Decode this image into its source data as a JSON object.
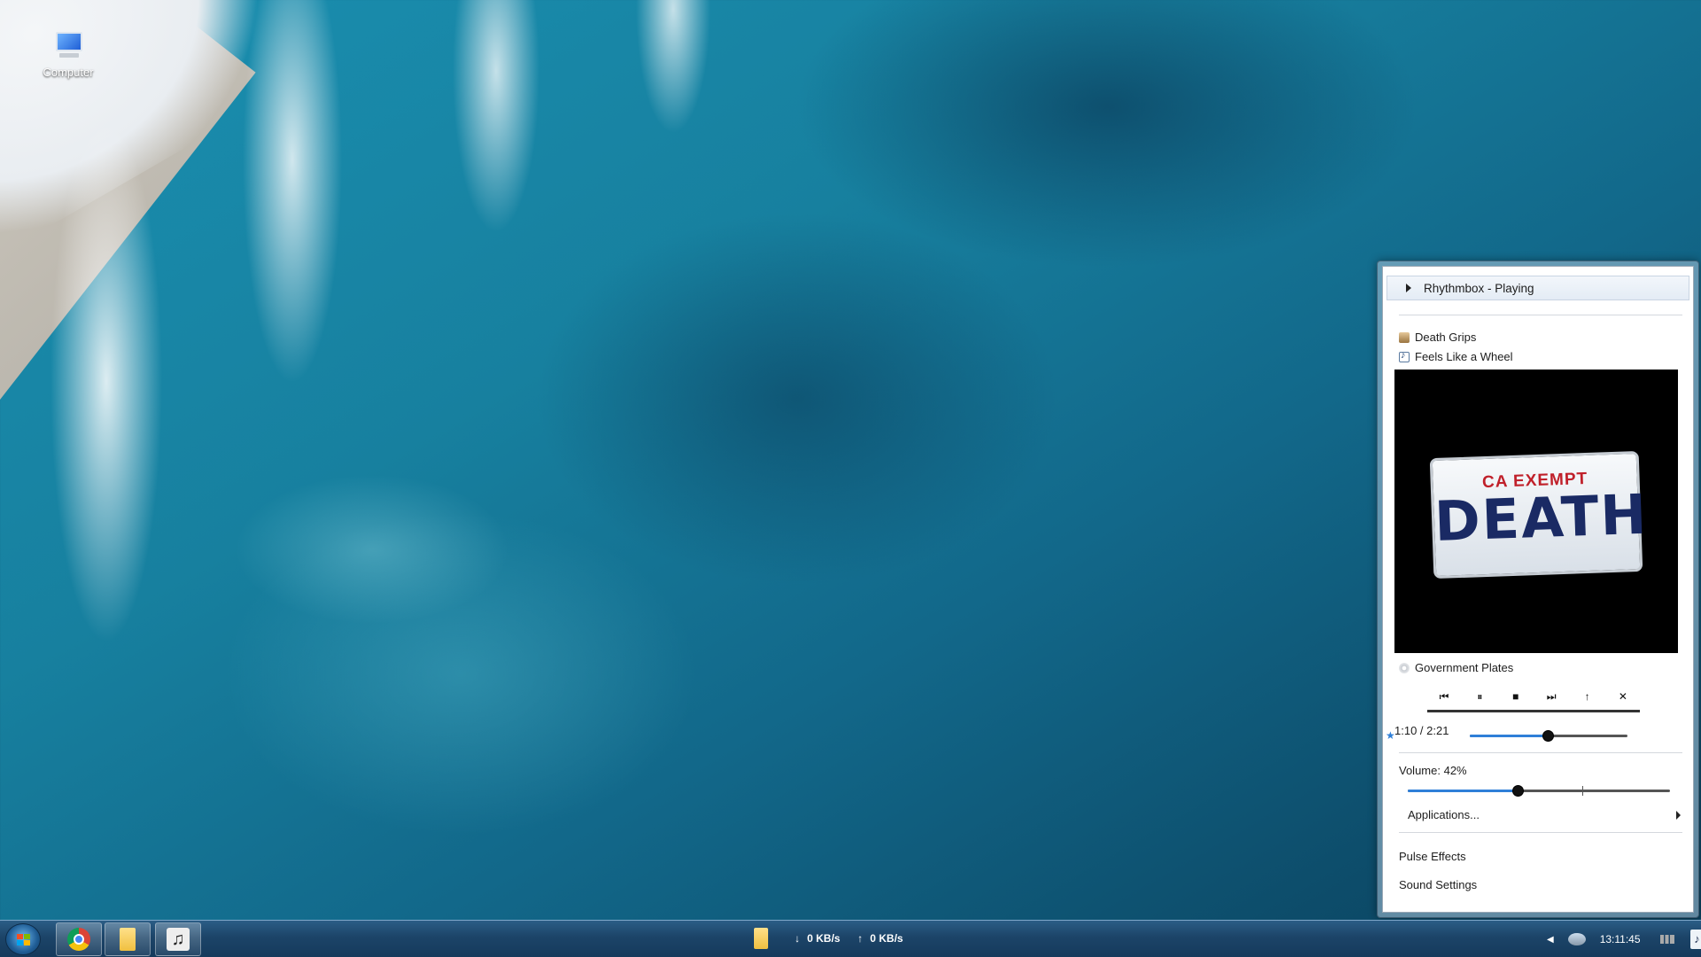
{
  "desktop": {
    "icons": [
      {
        "label": "Computer",
        "icon": "computer-icon"
      }
    ]
  },
  "sound_menu": {
    "player_header": "Rhythmbox - Playing",
    "artist": "Death Grips",
    "track": "Feels Like a Wheel",
    "album": "Government Plates",
    "album_art": {
      "plate_top": "CA EXEMPT",
      "plate_main": "DEATH"
    },
    "controls": [
      {
        "name": "previous",
        "glyph": "⏮"
      },
      {
        "name": "pause",
        "glyph": "⏸"
      },
      {
        "name": "stop",
        "glyph": "■"
      },
      {
        "name": "next",
        "glyph": "⏭"
      },
      {
        "name": "raise",
        "glyph": "↑"
      },
      {
        "name": "close",
        "glyph": "✕"
      }
    ],
    "position_text": "1:10 / 2:21",
    "position_fraction": 0.496,
    "volume_label": "Volume: 42%",
    "volume_fraction": 0.42,
    "applications_label": "Applications...",
    "pulse_effects_label": "Pulse Effects",
    "sound_settings_label": "Sound Settings"
  },
  "taskbar": {
    "download_speed": "0 KB/s",
    "upload_speed": "0 KB/s",
    "down_arrow": "↓",
    "up_arrow": "↑",
    "clock": "13:11:45",
    "tray_chevron": "◀"
  },
  "colors": {
    "accent": "#2f7fd8",
    "plate_red": "#c0202a",
    "plate_blue": "#1a2a64"
  }
}
